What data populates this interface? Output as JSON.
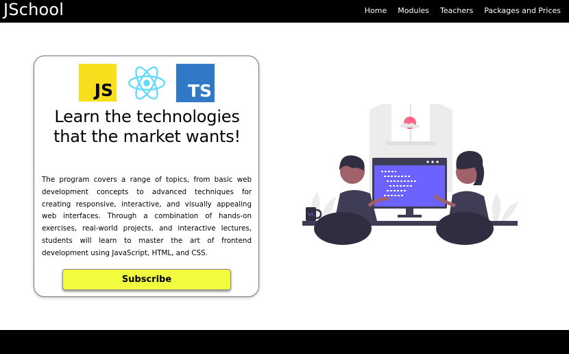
{
  "header": {
    "brand": "JSchool",
    "nav": [
      {
        "label": "Home"
      },
      {
        "label": "Modules"
      },
      {
        "label": "Teachers"
      },
      {
        "label": "Packages and Prices"
      }
    ]
  },
  "card": {
    "logos": {
      "js_label": "JS",
      "ts_label": "TS",
      "react_icon": "react-atom-icon",
      "js_color": "#f7df1e",
      "ts_color": "#3178c6",
      "react_color": "#61dafb"
    },
    "headline": "Learn the technologies that the market wants!",
    "description": "The program covers a range of topics, from basic web development concepts to advanced techniques for creating responsive, interactive, and visually appealing web interfaces. Through a combination of hands-on exercises, real-world projects, and interactive lectures, students will learn to master the art of frontend development using JavaScript, HTML, and CSS.",
    "subscribe_label": "Subscribe",
    "subscribe_color": "#f2fc3e"
  },
  "illustration": {
    "icon": "two-people-at-computer-illustration",
    "accent_color": "#6c63ff"
  }
}
